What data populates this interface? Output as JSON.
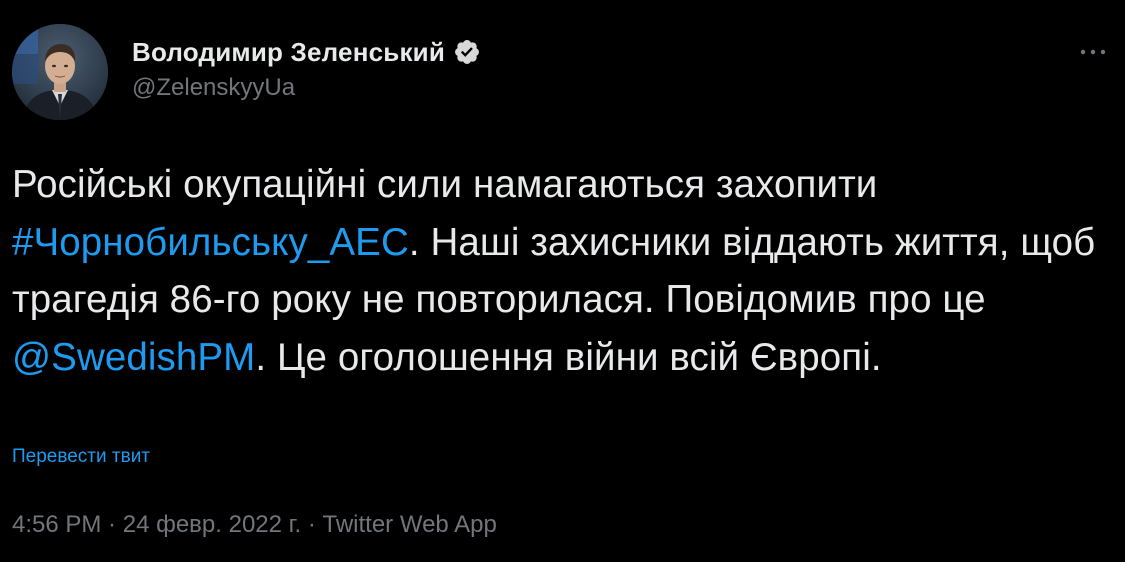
{
  "author": {
    "display_name": "Володимир Зеленський",
    "handle": "@ZelenskyyUa",
    "verified_icon": "verified-badge-icon"
  },
  "tweet": {
    "text_before_hashtag": "Російські окупаційні сили намагаються захопити ",
    "hashtag": "#Чорнобильську_АЕС",
    "text_after_hashtag": ". Наші захисники віддають життя, щоб трагедія 86-го року не повторилася. Повідомив про це ",
    "mention": "@SwedishPM",
    "text_after_mention": ". Це оголошення війни всій Європі."
  },
  "translate_label": "Перевести твит",
  "meta": {
    "time": "4:56 PM",
    "date": "24 февр. 2022 г.",
    "source": "Twitter Web App",
    "separator": " · "
  },
  "colors": {
    "background": "#000000",
    "text": "#e7e9ea",
    "secondary": "#71767b",
    "accent": "#1d9bf0"
  }
}
